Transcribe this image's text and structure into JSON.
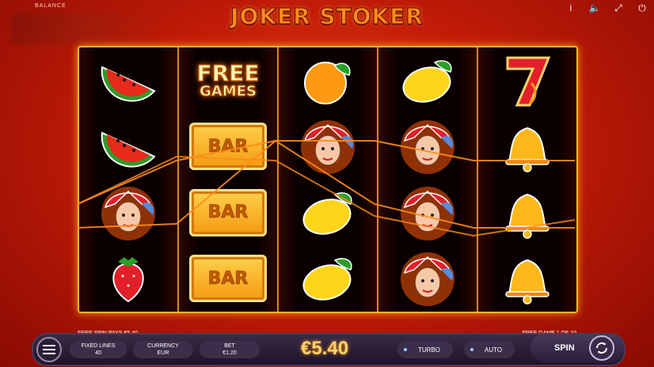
{
  "header": {
    "balance_label": "BALANCE",
    "title": "JOKER STOKER"
  },
  "top_icons": [
    "info-icon",
    "sound-icon",
    "fullscreen-icon",
    "power-icon"
  ],
  "top_icon_glyphs": [
    "i",
    "🔈",
    "⤢",
    "⏻"
  ],
  "reels": [
    [
      "watermelon",
      "watermelon",
      "joker",
      "strawberry"
    ],
    [
      "free-games",
      "bar",
      "bar",
      "bar"
    ],
    [
      "orange",
      "joker",
      "lemon",
      "lemon"
    ],
    [
      "lemon",
      "joker",
      "joker",
      "joker"
    ],
    [
      "seven",
      "bell",
      "bell",
      "bell"
    ]
  ],
  "symbols": {
    "bar_label": "BAR",
    "free_line1": "FREE",
    "free_line2": "GAMES"
  },
  "info": {
    "left": "FREE SPIN PAYS €5.40",
    "right": "FREE GAME 1 OF 10"
  },
  "controls": {
    "fixed_lines_label": "FIXED LINES",
    "fixed_lines_value": "40",
    "currency_label": "CURRENCY",
    "currency_value": "EUR",
    "bet_label": "BET",
    "bet_value": "€1.20",
    "win_amount": "€5.40",
    "turbo_label": "TURBO",
    "auto_label": "AUTO",
    "spin_label": "SPIN"
  },
  "colors": {
    "accent": "#ff9a1a",
    "frame": "#ffb32a",
    "panel": "#2a1e36"
  }
}
